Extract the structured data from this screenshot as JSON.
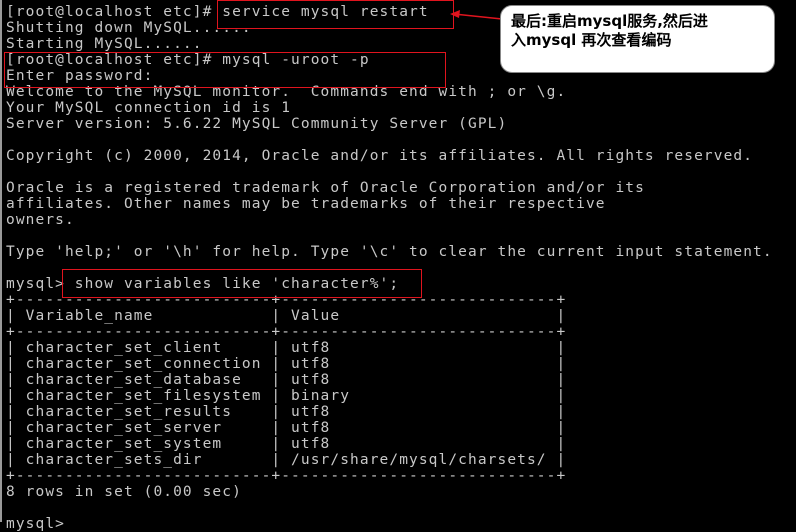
{
  "terminal": {
    "lines": [
      "",
      "[root@localhost etc]# service mysql restart",
      "Shutting down MySQL......",
      "Starting MySQL......",
      "[root@localhost etc]# mysql -uroot -p",
      "Enter password:",
      "Welcome to the MySQL monitor.  Commands end with ; or \\g.",
      "Your MySQL connection id is 1",
      "Server version: 5.6.22 MySQL Community Server (GPL)",
      "",
      "Copyright (c) 2000, 2014, Oracle and/or its affiliates. All rights reserved.",
      "",
      "Oracle is a registered trademark of Oracle Corporation and/or its",
      "affiliates. Other names may be trademarks of their respective",
      "owners.",
      "",
      "Type 'help;' or '\\h' for help. Type '\\c' to clear the current input statement.",
      "",
      "mysql> show variables like 'character%';",
      "+--------------------------+----------------------------+",
      "| Variable_name            | Value                      |",
      "+--------------------------+----------------------------+",
      "| character_set_client     | utf8                       |",
      "| character_set_connection | utf8                       |",
      "| character_set_database   | utf8                       |",
      "| character_set_filesystem | binary                     |",
      "| character_set_results    | utf8                       |",
      "| character_set_server     | utf8                       |",
      "| character_set_system     | utf8                       |",
      "| character_sets_dir       | /usr/share/mysql/charsets/ |",
      "+--------------------------+----------------------------+",
      "8 rows in set (0.00 sec)",
      "",
      "mysql> "
    ],
    "prompt": "[root@localhost etc]#",
    "commands": {
      "restart": "service mysql restart",
      "login": "mysql -uroot -p",
      "query": "show variables like 'character%';"
    },
    "table": {
      "columns": [
        "Variable_name",
        "Value"
      ],
      "rows": [
        [
          "character_set_client",
          "utf8"
        ],
        [
          "character_set_connection",
          "utf8"
        ],
        [
          "character_set_database",
          "utf8"
        ],
        [
          "character_set_filesystem",
          "binary"
        ],
        [
          "character_set_results",
          "utf8"
        ],
        [
          "character_set_server",
          "utf8"
        ],
        [
          "character_set_system",
          "utf8"
        ],
        [
          "character_sets_dir",
          "/usr/share/mysql/charsets/"
        ]
      ],
      "summary": "8 rows in set (0.00 sec)"
    }
  },
  "annotation": {
    "callout_text": "最后:重启mysql服务,然后进\n入mysql 再次查看编码",
    "highlight_color": "#e0141e"
  }
}
